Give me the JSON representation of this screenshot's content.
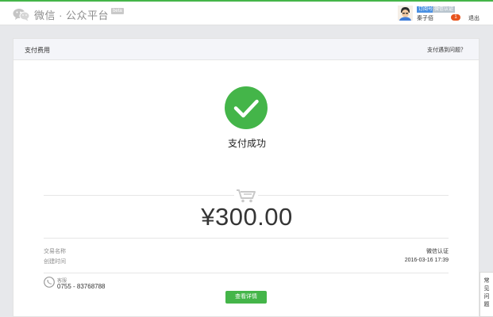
{
  "header": {
    "logo_text": "微信 · 公众平台",
    "beta": "beta",
    "account_type_tag": "订阅号",
    "verified_tag": "微信认证",
    "username": "秦子佰",
    "notice_count": "1",
    "logout": "退出"
  },
  "panel": {
    "title": "支付费用",
    "help_link": "支付遇到问题？",
    "status_text": "支付成功",
    "amount": "¥300.00",
    "rows": [
      {
        "label": "交易名称",
        "value": "微信认证"
      },
      {
        "label": "创建时间",
        "value": "2016-03-16 17:39"
      }
    ],
    "customer_service": {
      "label": "客服",
      "phone": "0755 - 83768788"
    },
    "detail_button": "查看详情"
  },
  "faq": [
    "常",
    "见",
    "问",
    "题"
  ],
  "colors": {
    "accent": "#44b549",
    "badge": "#e8541e",
    "tag_blue": "#4a90e2"
  },
  "icons": [
    "wechat-logo-icon",
    "success-check-icon",
    "shopping-cart-icon",
    "phone-icon"
  ]
}
